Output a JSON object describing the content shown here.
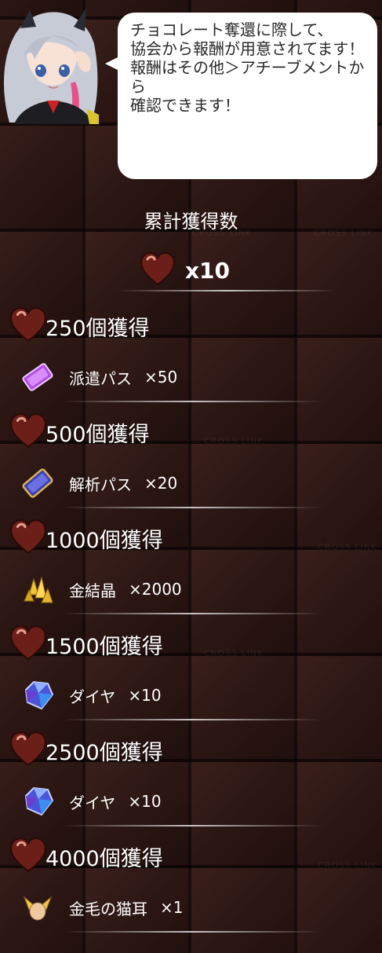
{
  "speech": {
    "text": "チョコレート奪還に際して、\n協会から報酬が用意されてます！\n報酬はその他＞アチーブメントから\n確認できます！"
  },
  "total": {
    "title": "累計獲得数",
    "count": "x10"
  },
  "background_emboss": "CROSS LINK",
  "milestones": [
    {
      "title": "250個獲得",
      "reward_name": "派遣パス",
      "reward_qty": "×50",
      "icon": "dispatch-pass-icon"
    },
    {
      "title": "500個獲得",
      "reward_name": "解析パス",
      "reward_qty": "×20",
      "icon": "analysis-pass-icon"
    },
    {
      "title": "1000個獲得",
      "reward_name": "金結晶",
      "reward_qty": "×2000",
      "icon": "gold-crystal-icon"
    },
    {
      "title": "1500個獲得",
      "reward_name": "ダイヤ",
      "reward_qty": "×10",
      "icon": "diamond-icon"
    },
    {
      "title": "2500個獲得",
      "reward_name": "ダイヤ",
      "reward_qty": "×10",
      "icon": "diamond-icon"
    },
    {
      "title": "4000個獲得",
      "reward_name": "金毛の猫耳",
      "reward_qty": "×1",
      "icon": "golden-cat-ears-icon"
    }
  ]
}
